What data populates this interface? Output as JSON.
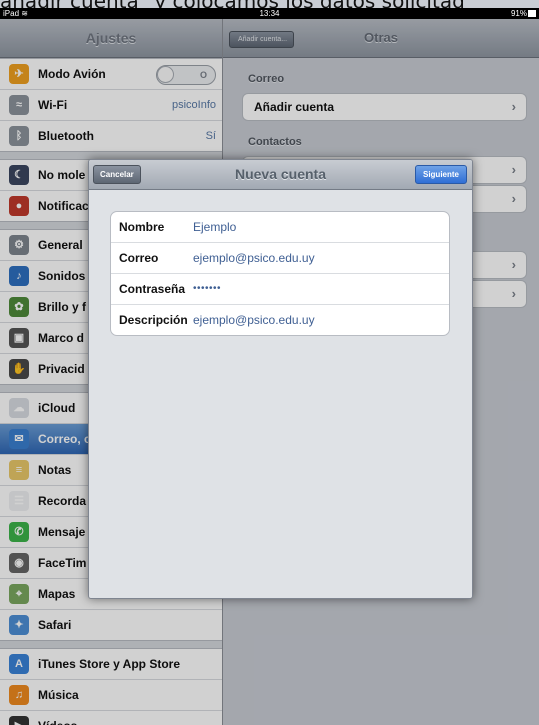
{
  "caption": "añadir cuenta\" y colocamos los datos solicitad",
  "status": {
    "left": "iPad",
    "time": "13:34",
    "battery": "91%"
  },
  "sidebar": {
    "title": "Ajustes",
    "groups": [
      [
        {
          "label": "Modo Avión",
          "icon": "airplane-icon",
          "color": "#f0a020",
          "glyph": "✈",
          "toggle": "O"
        },
        {
          "label": "Wi-Fi",
          "icon": "wifi-icon",
          "color": "#8c939c",
          "glyph": "≈",
          "value": "psicoInfo"
        },
        {
          "label": "Bluetooth",
          "icon": "bluetooth-icon",
          "color": "#8c939c",
          "glyph": "ᛒ",
          "value": "Sí"
        }
      ],
      [
        {
          "label": "No mole",
          "icon": "moon-icon",
          "color": "#3b4660",
          "glyph": "☾"
        },
        {
          "label": "Notificac",
          "icon": "notifications-icon",
          "color": "#c0392b",
          "glyph": "●"
        }
      ],
      [
        {
          "label": "General",
          "icon": "gear-icon",
          "color": "#7e858e",
          "glyph": "⚙"
        },
        {
          "label": "Sonidos",
          "icon": "speaker-icon",
          "color": "#2e6fc0",
          "glyph": "♪"
        },
        {
          "label": "Brillo y f",
          "icon": "flower-icon",
          "color": "#4f8a3a",
          "glyph": "✿"
        },
        {
          "label": "Marco d",
          "icon": "frame-icon",
          "color": "#555",
          "glyph": "▣"
        },
        {
          "label": "Privacid",
          "icon": "hand-icon",
          "color": "#4a4a4a",
          "glyph": "✋"
        }
      ],
      [
        {
          "label": "iCloud",
          "icon": "cloud-icon",
          "color": "#d8dce2",
          "glyph": "☁"
        },
        {
          "label": "Correo, c",
          "icon": "mail-icon",
          "color": "#3a7fd0",
          "glyph": "✉",
          "selected": true
        },
        {
          "label": "Notas",
          "icon": "notes-icon",
          "color": "#e9c96a",
          "glyph": "≡"
        },
        {
          "label": "Recorda",
          "icon": "reminders-icon",
          "color": "#eef0f2",
          "glyph": "☰"
        },
        {
          "label": "Mensaje",
          "icon": "messages-icon",
          "color": "#3cb44a",
          "glyph": "✆"
        },
        {
          "label": "FaceTim",
          "icon": "facetime-icon",
          "color": "#666",
          "glyph": "◉"
        },
        {
          "label": "Mapas",
          "icon": "maps-icon",
          "color": "#7aa860",
          "glyph": "⌖"
        },
        {
          "label": "Safari",
          "icon": "compass-icon",
          "color": "#4d8fd6",
          "glyph": "✦"
        }
      ],
      [
        {
          "label": "iTunes Store y App Store",
          "icon": "appstore-icon",
          "color": "#3a83d8",
          "glyph": "A"
        },
        {
          "label": "Música",
          "icon": "music-icon",
          "color": "#f08a1f",
          "glyph": "♫"
        },
        {
          "label": "Vídeos",
          "icon": "videos-icon",
          "color": "#333",
          "glyph": "▶"
        }
      ]
    ]
  },
  "detail": {
    "back_label": "Añadir cuenta...",
    "title": "Otras",
    "section_mail": "Correo",
    "add_account": "Añadir cuenta",
    "section_contacts": "Contactos"
  },
  "modal": {
    "title": "Nueva cuenta",
    "cancel": "Cancelar",
    "next": "Siguiente",
    "fields": [
      {
        "label": "Nombre",
        "value": "Ejemplo"
      },
      {
        "label": "Correo",
        "value": "ejemplo@psico.edu.uy"
      },
      {
        "label": "Contraseña",
        "value": "•••••••"
      },
      {
        "label": "Descripción",
        "value": "ejemplo@psico.edu.uy"
      }
    ]
  }
}
